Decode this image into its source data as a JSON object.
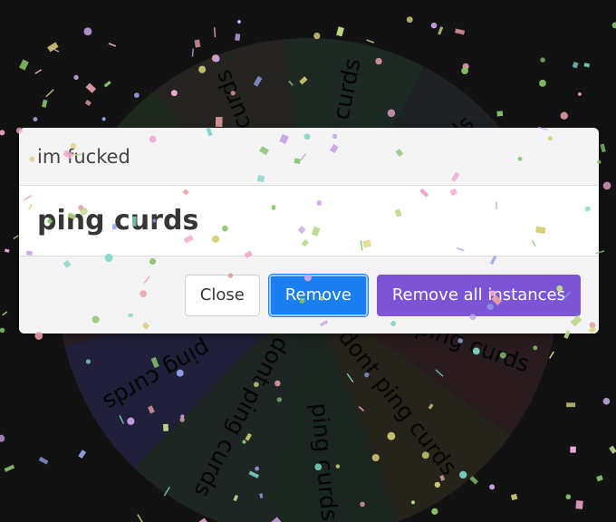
{
  "wheel": {
    "slices": [
      {
        "label": "ping curds",
        "color": "#1c2a23"
      },
      {
        "label": "ping curds",
        "color": "#1e2224"
      },
      {
        "label": "ping curds",
        "color": "#1e1e30"
      },
      {
        "label": "dont ping curds",
        "color": "#2a1c1e"
      },
      {
        "label": "dont ping curds",
        "color": "#26241a"
      },
      {
        "label": "ping curds",
        "color": "#1c2620"
      },
      {
        "label": "dont ping curds",
        "color": "#1e2624"
      },
      {
        "label": "ping curds",
        "color": "#20203a"
      },
      {
        "label": "ping curds",
        "color": "#2a1f24"
      },
      {
        "label": "ping curds",
        "color": "#1f2a1f"
      },
      {
        "label": "ping curds",
        "color": "#262420"
      }
    ]
  },
  "confetti": {
    "colors": [
      "#86c36b",
      "#c7a3e6",
      "#e8a0a6",
      "#d8d27a",
      "#8fa0e6",
      "#7fd4c4",
      "#b9d98a",
      "#f0a8d0"
    ]
  },
  "modal": {
    "title": "im fucked",
    "result": "ping curds",
    "close_label": "Close",
    "remove_label": "Remove",
    "remove_all_label": "Remove all instances"
  }
}
